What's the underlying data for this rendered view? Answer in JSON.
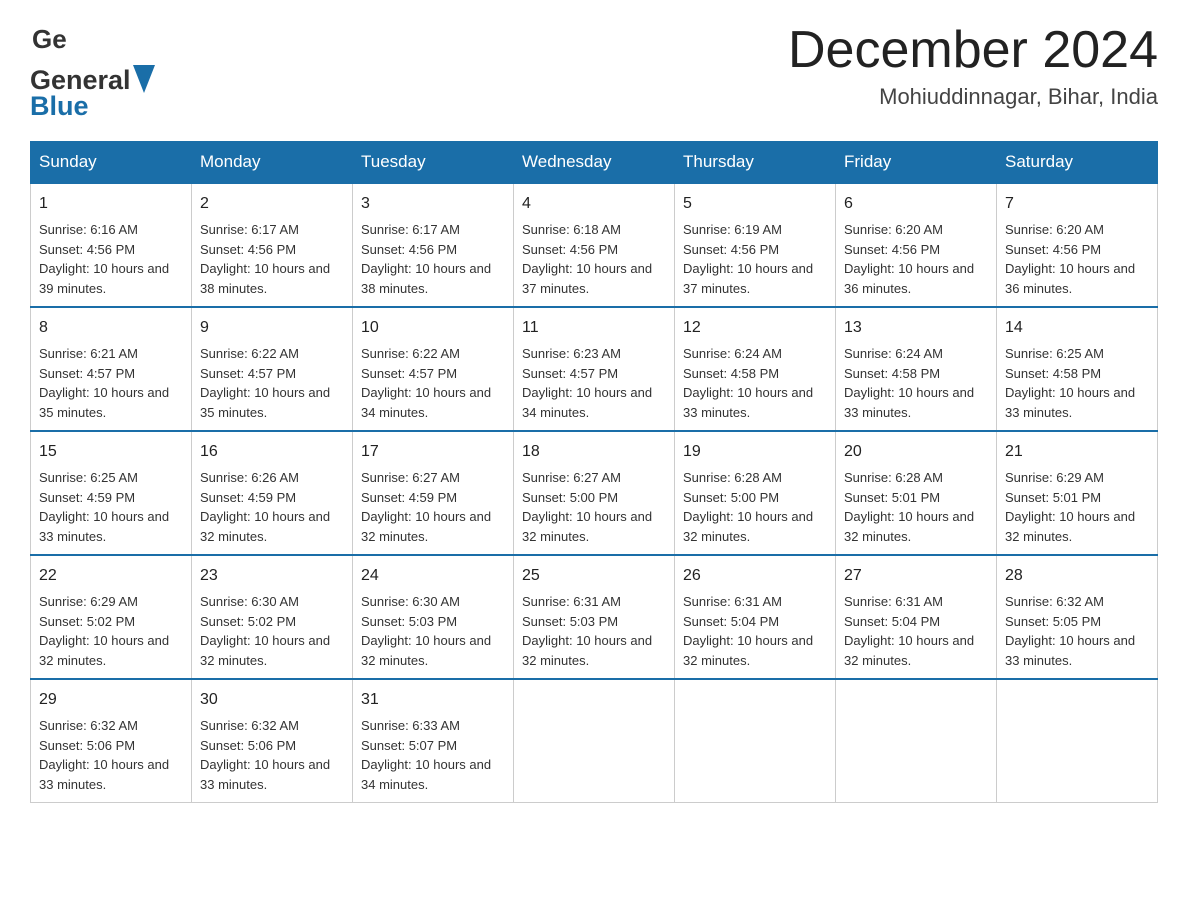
{
  "header": {
    "logo_general": "General",
    "logo_blue": "Blue",
    "title": "December 2024",
    "subtitle": "Mohiuddinnagar, Bihar, India"
  },
  "calendar": {
    "days_of_week": [
      "Sunday",
      "Monday",
      "Tuesday",
      "Wednesday",
      "Thursday",
      "Friday",
      "Saturday"
    ],
    "weeks": [
      [
        {
          "day": "1",
          "sunrise": "6:16 AM",
          "sunset": "4:56 PM",
          "daylight": "10 hours and 39 minutes."
        },
        {
          "day": "2",
          "sunrise": "6:17 AM",
          "sunset": "4:56 PM",
          "daylight": "10 hours and 38 minutes."
        },
        {
          "day": "3",
          "sunrise": "6:17 AM",
          "sunset": "4:56 PM",
          "daylight": "10 hours and 38 minutes."
        },
        {
          "day": "4",
          "sunrise": "6:18 AM",
          "sunset": "4:56 PM",
          "daylight": "10 hours and 37 minutes."
        },
        {
          "day": "5",
          "sunrise": "6:19 AM",
          "sunset": "4:56 PM",
          "daylight": "10 hours and 37 minutes."
        },
        {
          "day": "6",
          "sunrise": "6:20 AM",
          "sunset": "4:56 PM",
          "daylight": "10 hours and 36 minutes."
        },
        {
          "day": "7",
          "sunrise": "6:20 AM",
          "sunset": "4:56 PM",
          "daylight": "10 hours and 36 minutes."
        }
      ],
      [
        {
          "day": "8",
          "sunrise": "6:21 AM",
          "sunset": "4:57 PM",
          "daylight": "10 hours and 35 minutes."
        },
        {
          "day": "9",
          "sunrise": "6:22 AM",
          "sunset": "4:57 PM",
          "daylight": "10 hours and 35 minutes."
        },
        {
          "day": "10",
          "sunrise": "6:22 AM",
          "sunset": "4:57 PM",
          "daylight": "10 hours and 34 minutes."
        },
        {
          "day": "11",
          "sunrise": "6:23 AM",
          "sunset": "4:57 PM",
          "daylight": "10 hours and 34 minutes."
        },
        {
          "day": "12",
          "sunrise": "6:24 AM",
          "sunset": "4:58 PM",
          "daylight": "10 hours and 33 minutes."
        },
        {
          "day": "13",
          "sunrise": "6:24 AM",
          "sunset": "4:58 PM",
          "daylight": "10 hours and 33 minutes."
        },
        {
          "day": "14",
          "sunrise": "6:25 AM",
          "sunset": "4:58 PM",
          "daylight": "10 hours and 33 minutes."
        }
      ],
      [
        {
          "day": "15",
          "sunrise": "6:25 AM",
          "sunset": "4:59 PM",
          "daylight": "10 hours and 33 minutes."
        },
        {
          "day": "16",
          "sunrise": "6:26 AM",
          "sunset": "4:59 PM",
          "daylight": "10 hours and 32 minutes."
        },
        {
          "day": "17",
          "sunrise": "6:27 AM",
          "sunset": "4:59 PM",
          "daylight": "10 hours and 32 minutes."
        },
        {
          "day": "18",
          "sunrise": "6:27 AM",
          "sunset": "5:00 PM",
          "daylight": "10 hours and 32 minutes."
        },
        {
          "day": "19",
          "sunrise": "6:28 AM",
          "sunset": "5:00 PM",
          "daylight": "10 hours and 32 minutes."
        },
        {
          "day": "20",
          "sunrise": "6:28 AM",
          "sunset": "5:01 PM",
          "daylight": "10 hours and 32 minutes."
        },
        {
          "day": "21",
          "sunrise": "6:29 AM",
          "sunset": "5:01 PM",
          "daylight": "10 hours and 32 minutes."
        }
      ],
      [
        {
          "day": "22",
          "sunrise": "6:29 AM",
          "sunset": "5:02 PM",
          "daylight": "10 hours and 32 minutes."
        },
        {
          "day": "23",
          "sunrise": "6:30 AM",
          "sunset": "5:02 PM",
          "daylight": "10 hours and 32 minutes."
        },
        {
          "day": "24",
          "sunrise": "6:30 AM",
          "sunset": "5:03 PM",
          "daylight": "10 hours and 32 minutes."
        },
        {
          "day": "25",
          "sunrise": "6:31 AM",
          "sunset": "5:03 PM",
          "daylight": "10 hours and 32 minutes."
        },
        {
          "day": "26",
          "sunrise": "6:31 AM",
          "sunset": "5:04 PM",
          "daylight": "10 hours and 32 minutes."
        },
        {
          "day": "27",
          "sunrise": "6:31 AM",
          "sunset": "5:04 PM",
          "daylight": "10 hours and 32 minutes."
        },
        {
          "day": "28",
          "sunrise": "6:32 AM",
          "sunset": "5:05 PM",
          "daylight": "10 hours and 33 minutes."
        }
      ],
      [
        {
          "day": "29",
          "sunrise": "6:32 AM",
          "sunset": "5:06 PM",
          "daylight": "10 hours and 33 minutes."
        },
        {
          "day": "30",
          "sunrise": "6:32 AM",
          "sunset": "5:06 PM",
          "daylight": "10 hours and 33 minutes."
        },
        {
          "day": "31",
          "sunrise": "6:33 AM",
          "sunset": "5:07 PM",
          "daylight": "10 hours and 34 minutes."
        },
        null,
        null,
        null,
        null
      ]
    ]
  }
}
